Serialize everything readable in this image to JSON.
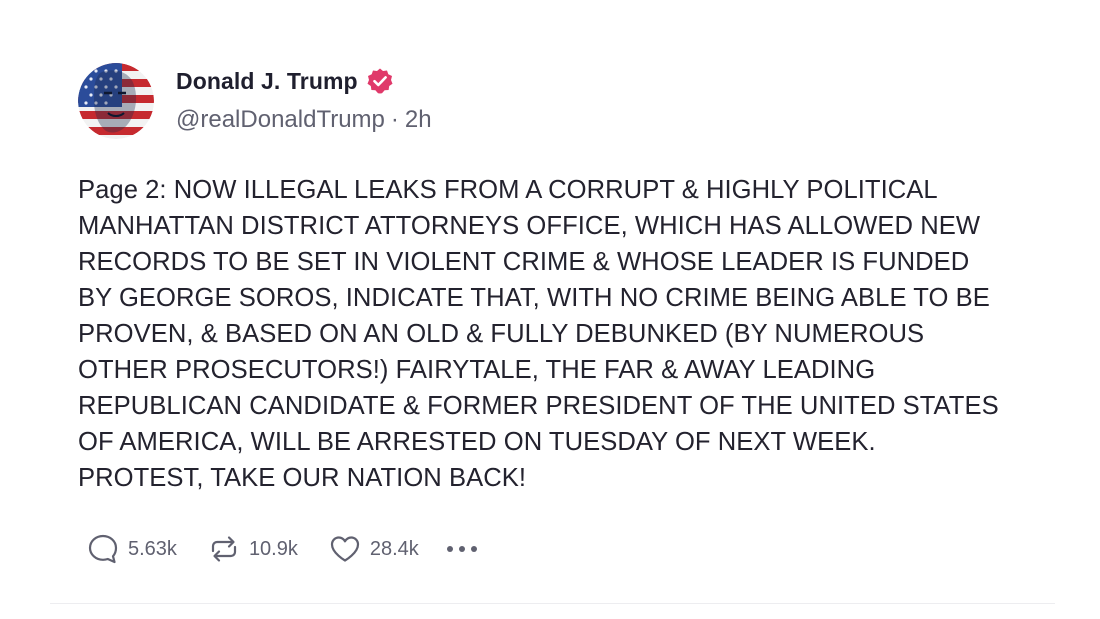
{
  "author": {
    "display_name": "Donald J. Trump",
    "handle": "@realDonaldTrump",
    "separator": "·",
    "time": "2h",
    "verified_color": "#e0396a"
  },
  "post": {
    "text": "Page 2: NOW ILLEGAL LEAKS FROM A CORRUPT & HIGHLY POLITICAL\nMANHATTAN DISTRICT ATTORNEYS OFFICE, WHICH HAS ALLOWED NEW\nRECORDS TO BE SET IN VIOLENT CRIME & WHOSE LEADER IS FUNDED\nBY GEORGE SOROS, INDICATE THAT, WITH NO CRIME BEING ABLE TO BE\nPROVEN, & BASED ON AN OLD & FULLY DEBUNKED (BY NUMEROUS\nOTHER PROSECUTORS!) FAIRYTALE, THE FAR & AWAY LEADING\nREPUBLICAN CANDIDATE & FORMER PRESIDENT OF THE UNITED STATES\nOF AMERICA, WILL BE ARRESTED ON TUESDAY OF NEXT WEEK.\nPROTEST, TAKE OUR NATION BACK!"
  },
  "actions": {
    "reply_count": "5.63k",
    "retruth_count": "10.9k",
    "like_count": "28.4k",
    "icons": [
      "reply-icon",
      "retruth-icon",
      "heart-icon",
      "more-icon"
    ]
  }
}
